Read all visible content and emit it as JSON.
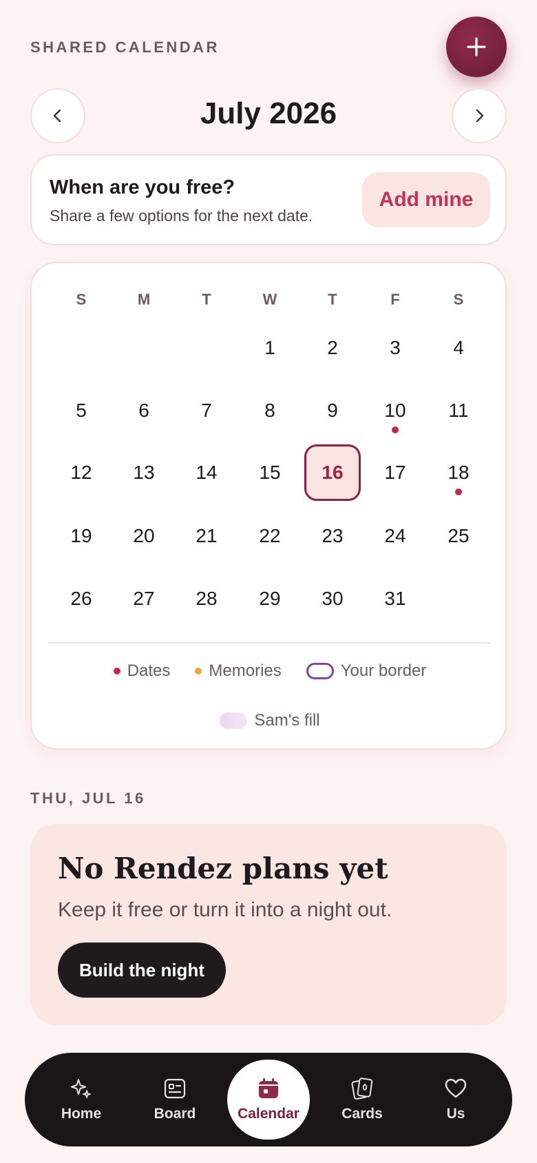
{
  "header": {
    "section_label": "SHARED CALENDAR",
    "month_title": "July 2026",
    "fab_icon": "plus-icon",
    "prev_icon": "chevron-left-icon",
    "next_icon": "chevron-right-icon"
  },
  "availability": {
    "title": "When are you free?",
    "subtitle": "Share a few options for the next date.",
    "button_label": "Add mine"
  },
  "calendar": {
    "weekdays": [
      "S",
      "M",
      "T",
      "W",
      "T",
      "F",
      "S"
    ],
    "first_weekday_index": 3,
    "days_in_month": 31,
    "selected_day": 16,
    "days_with_date_dots": [
      10,
      18
    ],
    "days": [
      "1",
      "2",
      "3",
      "4",
      "5",
      "6",
      "7",
      "8",
      "9",
      "10",
      "11",
      "12",
      "13",
      "14",
      "15",
      "16",
      "17",
      "18",
      "19",
      "20",
      "21",
      "22",
      "23",
      "24",
      "25",
      "26",
      "27",
      "28",
      "29",
      "30",
      "31"
    ],
    "legend": {
      "dates": "Dates",
      "memories": "Memories",
      "your_border": "Your border",
      "sams_fill": "Sam's fill"
    },
    "colors": {
      "dates_dot": "#c7284c",
      "memories_dot": "#f0a53a",
      "your_border": "#7a4aa1",
      "sams_fill": "#ead8ef",
      "selected_border": "#8e1f3f"
    }
  },
  "selected": {
    "label": "THU, JUL 16",
    "plan_title": "No Rendez plans yet",
    "plan_subtitle": "Keep it free or turn it into a night out.",
    "button_label": "Build the night"
  },
  "tabbar": {
    "items": [
      {
        "label": "Home",
        "icon": "sparkle-icon"
      },
      {
        "label": "Board",
        "icon": "board-icon"
      },
      {
        "label": "Calendar",
        "icon": "calendar-icon",
        "active": true
      },
      {
        "label": "Cards",
        "icon": "cards-icon"
      },
      {
        "label": "Us",
        "icon": "heart-icon"
      }
    ]
  }
}
